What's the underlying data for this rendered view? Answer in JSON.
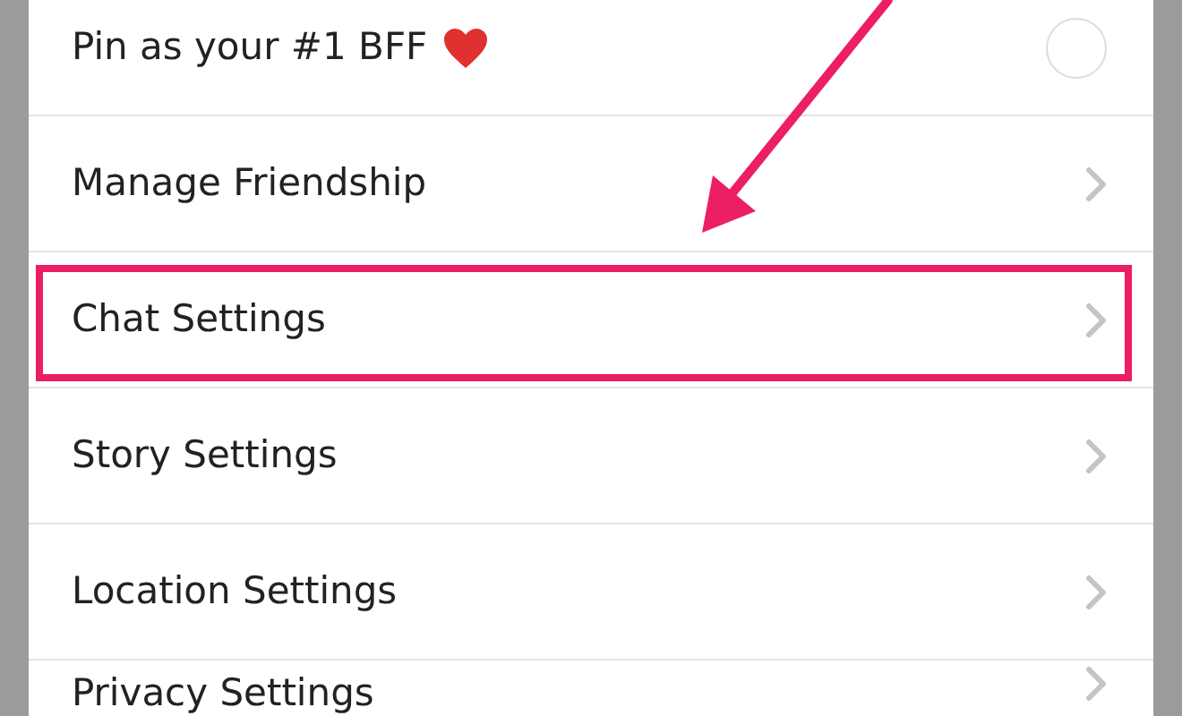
{
  "menu": {
    "items": [
      {
        "kind": "toggle",
        "label": "Pin as your #1 BFF",
        "checked": false,
        "highlighted": false
      },
      {
        "kind": "link",
        "label": "Manage Friendship",
        "highlighted": false
      },
      {
        "kind": "link",
        "label": "Chat Settings",
        "highlighted": true
      },
      {
        "kind": "link",
        "label": "Story Settings",
        "highlighted": false
      },
      {
        "kind": "link",
        "label": "Location Settings",
        "highlighted": false
      },
      {
        "kind": "link",
        "label": "Privacy Settings",
        "highlighted": false
      }
    ]
  }
}
